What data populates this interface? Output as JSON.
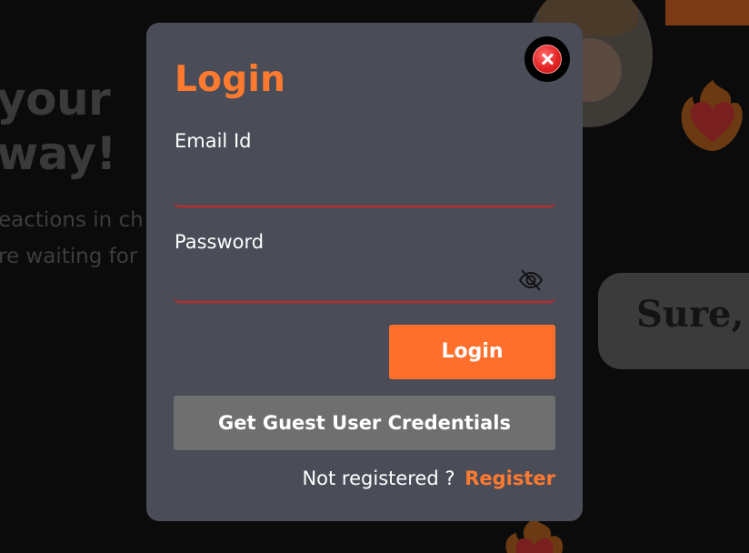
{
  "background": {
    "hero_line_1": "your",
    "hero_line_2": "way!",
    "hero_sub_1": "eactions in ch",
    "hero_sub_2": "re waiting for",
    "chat_bubble_text": "Sure, s"
  },
  "modal": {
    "title": "Login",
    "close_icon": "close-icon",
    "email": {
      "label": "Email Id",
      "value": "",
      "placeholder": ""
    },
    "password": {
      "label": "Password",
      "value": "",
      "placeholder": "",
      "toggle_icon": "eye-slash-icon"
    },
    "login_button": "Login",
    "guest_button": "Get Guest User Credentials",
    "register_prompt": "Not registered ?",
    "register_link": "Register"
  },
  "colors": {
    "accent": "#ff7a2f",
    "modal_bg": "#4a4d58",
    "input_underline": "#c62828",
    "guest_button_bg": "#6f6f6f",
    "page_bg": "#0b0b0b"
  }
}
